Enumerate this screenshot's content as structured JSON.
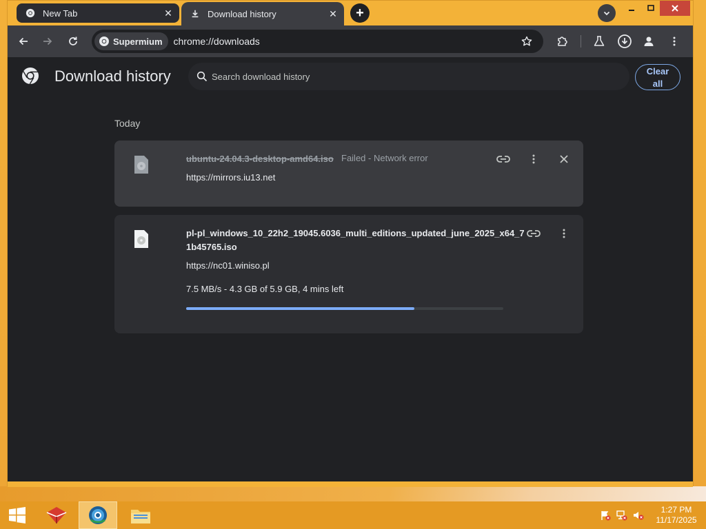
{
  "browser": {
    "tabs": [
      {
        "label": "New Tab",
        "state": "inactive"
      },
      {
        "label": "Download history",
        "state": "active"
      }
    ],
    "address": {
      "site_chip": "Supermium",
      "url": "chrome://downloads"
    }
  },
  "downloads_page": {
    "title": "Download history",
    "search_placeholder": "Search download history",
    "clear_all_line1": "Clear",
    "clear_all_line2": "all",
    "section_label": "Today",
    "items": [
      {
        "filename": "ubuntu-24.04.3-desktop-amd64.iso",
        "status": "Failed - Network error",
        "url": "https://mirrors.iu13.net"
      },
      {
        "filename_line1": "pl-pl_windows_10_22h2_19045.6036_multi_editions_updated_june_2025_x64_7",
        "filename_line2": "1b45765.iso",
        "url": "https://nc01.winiso.pl",
        "progress_text": "7.5 MB/s - 4.3 GB of 5.9 GB, 4 mins left",
        "progress_fraction": 0.72
      }
    ]
  },
  "taskbar": {
    "clock_time": "1:27 PM",
    "clock_date": "11/17/2025"
  },
  "colors": {
    "accent_blue": "#7cacf8",
    "page_bg": "#202124",
    "titlebar_orange": "#f3b238"
  }
}
